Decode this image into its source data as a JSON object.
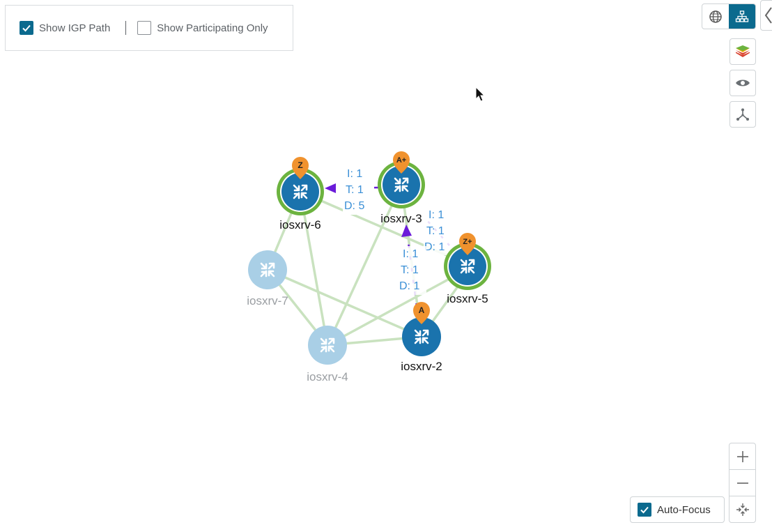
{
  "filters": {
    "show_igp_path": {
      "label": "Show IGP Path",
      "checked": true
    },
    "show_participating_only": {
      "label": "Show Participating Only",
      "checked": false
    }
  },
  "toolbar": {
    "view_toggle": [
      "globe-icon",
      "hierarchy-icon"
    ],
    "active_view": "hierarchy-icon",
    "buttons": [
      "layers-icon",
      "eye-icon",
      "topology-icon"
    ]
  },
  "zoom": {
    "in": "+",
    "out": "−"
  },
  "auto_focus": {
    "label": "Auto-Focus",
    "checked": true
  },
  "topology": {
    "nodes": [
      {
        "id": "iosxrv-6",
        "label": "iosxrv-6",
        "state": "active",
        "ring": true,
        "badge": "Z"
      },
      {
        "id": "iosxrv-3",
        "label": "iosxrv-3",
        "state": "active",
        "ring": true,
        "badge": "A+"
      },
      {
        "id": "iosxrv-5",
        "label": "iosxrv-5",
        "state": "active",
        "ring": true,
        "badge": "Z+"
      },
      {
        "id": "iosxrv-7",
        "label": "iosxrv-7",
        "state": "faded",
        "ring": false,
        "badge": ""
      },
      {
        "id": "iosxrv-4",
        "label": "iosxrv-4",
        "state": "faded",
        "ring": false,
        "badge": ""
      },
      {
        "id": "iosxrv-2",
        "label": "iosxrv-2",
        "state": "active",
        "ring": false,
        "badge": "A"
      }
    ],
    "metrics": {
      "link_3_6": [
        "I: 1",
        "T: 1",
        "D: 5"
      ],
      "link_5_3": [
        "I: 1",
        "T: 1",
        "D: 1"
      ],
      "link_2_3": [
        "I: 1",
        "T: 1",
        "D: 1"
      ]
    }
  },
  "colors": {
    "accent": "#0b6a8e",
    "node_active": "#1a73ad",
    "node_faded": "#a9cfe6",
    "ring": "#6cb33f",
    "badge": "#f0922e",
    "link": "#c9e2bf",
    "path": "#6a1bd9",
    "metric_text": "#3a8fd6"
  }
}
